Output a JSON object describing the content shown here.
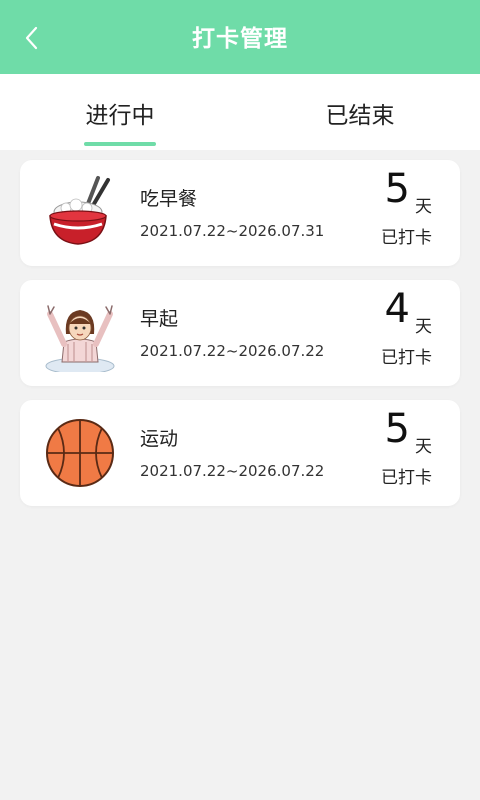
{
  "header": {
    "title": "打卡管理",
    "back_icon": "chevron-left-icon"
  },
  "tabs": [
    {
      "label": "进行中",
      "active": true
    },
    {
      "label": "已结束",
      "active": false
    }
  ],
  "theme": {
    "accent": "#6fdca8",
    "background": "#f2f2f2",
    "card": "#ffffff"
  },
  "habits": [
    {
      "name": "吃早餐",
      "range": "2021.07.22~2026.07.31",
      "count": "5",
      "unit": "天",
      "status": "已打卡",
      "icon": "rice-bowl-icon"
    },
    {
      "name": "早起",
      "range": "2021.07.22~2026.07.22",
      "count": "4",
      "unit": "天",
      "status": "已打卡",
      "icon": "wake-up-girl-icon"
    },
    {
      "name": "运动",
      "range": "2021.07.22~2026.07.22",
      "count": "5",
      "unit": "天",
      "status": "已打卡",
      "icon": "basketball-icon"
    }
  ]
}
